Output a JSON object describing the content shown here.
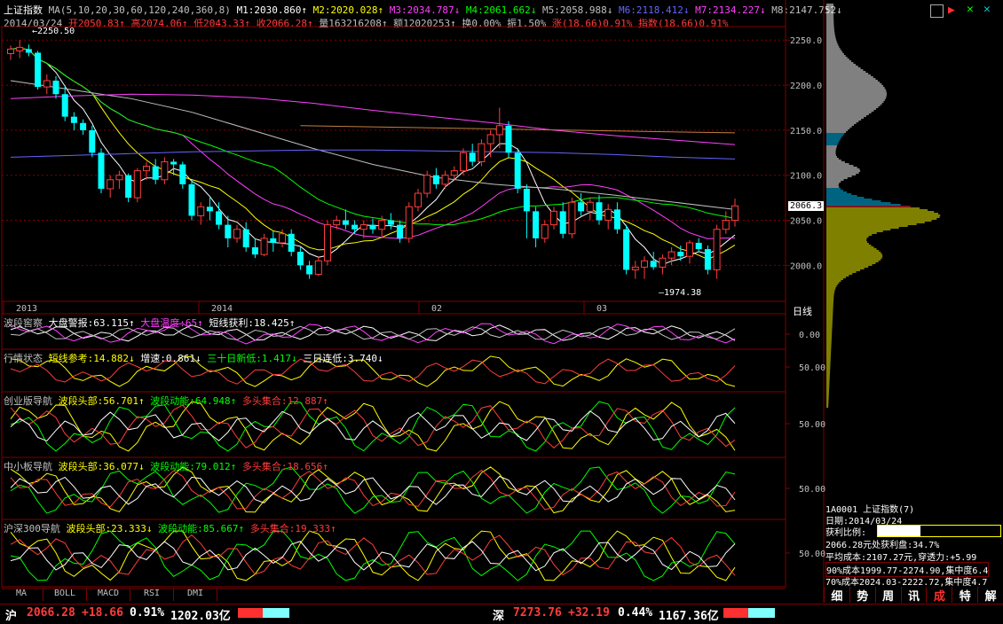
{
  "header": {
    "title": "上证指数",
    "ma_params": "MA(5,10,20,30,60,120,240,360,8)",
    "ma": [
      {
        "label": "M1:2030.860↑",
        "color": "#ffffff"
      },
      {
        "label": "M2:2020.028↑",
        "color": "#ffff00"
      },
      {
        "label": "M3:2034.787↓",
        "color": "#ff40ff"
      },
      {
        "label": "M4:2061.662↓",
        "color": "#00ff00"
      },
      {
        "label": "M5:2058.988↓",
        "color": "#c0c0c0"
      },
      {
        "label": "M6:2118.412↓",
        "color": "#6464ff"
      },
      {
        "label": "M7:2134.227↓",
        "color": "#ff40ff"
      },
      {
        "label": "M8:2147.752↓",
        "color": "#c0c0c0"
      }
    ],
    "date": "2014/03/24",
    "open": "开2050.83↑",
    "high": "高2074.06↑",
    "low": "低2043.33↑",
    "close": "收2066.28↑",
    "volume": "量163216208↑",
    "amount": "额12020253↑",
    "turnover": "换0.00%",
    "amplitude": "振1.50%",
    "change": "涨(18.66)0.91%",
    "index_chg": "指数(18.66)0.91%"
  },
  "price_chart": {
    "high_label": "2250.50",
    "low_label": "1974.38",
    "current_label": "2066.3",
    "yticks": [
      "2250.0",
      "2200.0",
      "2150.0",
      "2100.0",
      "2050.0",
      "2000.0"
    ],
    "xticks": [
      "2013",
      "2014",
      "02",
      "03"
    ],
    "period": "日线"
  },
  "panels": [
    {
      "name": "波段窖察",
      "items": [
        {
          "t": "大盘警报:63.115↑",
          "c": "#ffffff"
        },
        {
          "t": "大盘温度:65↑",
          "c": "#ff40ff"
        },
        {
          "t": "短线获利:18.425↑",
          "c": "#ffffff"
        }
      ],
      "tick": "0.00"
    },
    {
      "name": "行情状态",
      "items": [
        {
          "t": "短线参考:14.882↓",
          "c": "#ffff00"
        },
        {
          "t": "增速:0.861↓",
          "c": "#ffffff"
        },
        {
          "t": "三十日新低:1.417↓",
          "c": "#00ff00"
        },
        {
          "t": "三日连低:3.740↓",
          "c": "#ffffff"
        }
      ],
      "tick": "50.00"
    },
    {
      "name": "创业版导航",
      "items": [
        {
          "t": "波段头部:56.701↑",
          "c": "#ffff00"
        },
        {
          "t": "波段动能:64.948↑",
          "c": "#00ff00"
        },
        {
          "t": "多头集合:12.887↑",
          "c": "#ff3c3c"
        }
      ],
      "tick": "50.00"
    },
    {
      "name": "中小板导航",
      "items": [
        {
          "t": "波段头部:36.077↓",
          "c": "#ffff00"
        },
        {
          "t": "波段动能:79.012↑",
          "c": "#00ff00"
        },
        {
          "t": "多头集合:18.656↑",
          "c": "#ff3c3c"
        }
      ],
      "tick": "50.00"
    },
    {
      "name": "沪深300导航",
      "items": [
        {
          "t": "波段头部:23.333↓",
          "c": "#ffff00"
        },
        {
          "t": "波段动能:85.667↑",
          "c": "#00ff00"
        },
        {
          "t": "多头集合:19.333↑",
          "c": "#ff3c3c"
        }
      ],
      "tick": "50.00"
    }
  ],
  "tabs": [
    "MA",
    "BOLL",
    "MACD",
    "RSI",
    "DMI"
  ],
  "side_info": {
    "code": "1A0001 上证指数(7)",
    "date": "日期:2014/03/24",
    "profit_label": "获利比例:",
    "profit_value": "34.7%",
    "profit_fraction": 0.347,
    "line1": "2066.28元处获利盘:34.7%",
    "line2": "平均成本:2107.27元,穿透力:+5.99",
    "line3": "90%成本1999.77-2274.90,集中度6.4",
    "line4": "70%成本2024.03-2222.72,集中度4.7"
  },
  "side_tabs": [
    "细",
    "势",
    "周",
    "讯",
    "成",
    "特",
    "解"
  ],
  "status": {
    "sh_label": "沪",
    "sh_price": "2066.28",
    "sh_chg": "+18.66",
    "sh_pct": "0.91%",
    "sh_amt": "1202.03亿",
    "sz_label": "深",
    "sz_price": "7273.76",
    "sz_chg": "+32.19",
    "sz_pct": "0.44%",
    "sz_amt": "1167.36亿"
  },
  "chart_data": {
    "type": "candlestick",
    "ylim": [
      1960,
      2265
    ],
    "candles": [
      [
        2235,
        2244,
        2228,
        2240
      ],
      [
        2238,
        2250,
        2230,
        2242
      ],
      [
        2240,
        2245,
        2232,
        2236
      ],
      [
        2236,
        2238,
        2195,
        2198
      ],
      [
        2198,
        2212,
        2190,
        2205
      ],
      [
        2205,
        2210,
        2185,
        2190
      ],
      [
        2190,
        2200,
        2160,
        2165
      ],
      [
        2165,
        2170,
        2150,
        2158
      ],
      [
        2158,
        2162,
        2145,
        2150
      ],
      [
        2150,
        2155,
        2120,
        2125
      ],
      [
        2125,
        2130,
        2080,
        2085
      ],
      [
        2085,
        2100,
        2075,
        2095
      ],
      [
        2095,
        2105,
        2085,
        2100
      ],
      [
        2100,
        2102,
        2070,
        2075
      ],
      [
        2075,
        2108,
        2070,
        2105
      ],
      [
        2105,
        2115,
        2095,
        2110
      ],
      [
        2110,
        2118,
        2090,
        2095
      ],
      [
        2095,
        2120,
        2090,
        2115
      ],
      [
        2115,
        2118,
        2100,
        2112
      ],
      [
        2112,
        2115,
        2085,
        2090
      ],
      [
        2090,
        2095,
        2050,
        2055
      ],
      [
        2055,
        2070,
        2045,
        2065
      ],
      [
        2065,
        2075,
        2050,
        2060
      ],
      [
        2060,
        2070,
        2040,
        2045
      ],
      [
        2045,
        2055,
        2020,
        2030
      ],
      [
        2030,
        2045,
        2025,
        2040
      ],
      [
        2040,
        2048,
        2015,
        2020
      ],
      [
        2020,
        2030,
        2008,
        2012
      ],
      [
        2012,
        2035,
        2010,
        2030
      ],
      [
        2030,
        2038,
        2015,
        2025
      ],
      [
        2025,
        2040,
        2020,
        2035
      ],
      [
        2035,
        2040,
        2010,
        2015
      ],
      [
        2015,
        2020,
        1995,
        2000
      ],
      [
        2000,
        2005,
        1985,
        1990
      ],
      [
        1990,
        2010,
        1988,
        2005
      ],
      [
        2005,
        2050,
        2000,
        2045
      ],
      [
        2045,
        2055,
        2040,
        2050
      ],
      [
        2050,
        2062,
        2040,
        2045
      ],
      [
        2045,
        2050,
        2035,
        2040
      ],
      [
        2040,
        2050,
        2030,
        2045
      ],
      [
        2045,
        2052,
        2035,
        2040
      ],
      [
        2040,
        2055,
        2030,
        2050
      ],
      [
        2050,
        2058,
        2040,
        2045
      ],
      [
        2045,
        2050,
        2025,
        2030
      ],
      [
        2030,
        2070,
        2025,
        2065
      ],
      [
        2065,
        2085,
        2060,
        2080
      ],
      [
        2080,
        2105,
        2075,
        2100
      ],
      [
        2100,
        2108,
        2085,
        2090
      ],
      [
        2090,
        2105,
        2085,
        2100
      ],
      [
        2100,
        2110,
        2095,
        2105
      ],
      [
        2105,
        2130,
        2100,
        2125
      ],
      [
        2125,
        2135,
        2110,
        2115
      ],
      [
        2115,
        2140,
        2110,
        2135
      ],
      [
        2135,
        2150,
        2120,
        2145
      ],
      [
        2145,
        2175,
        2130,
        2155
      ],
      [
        2155,
        2160,
        2120,
        2125
      ],
      [
        2125,
        2130,
        2080,
        2085
      ],
      [
        2085,
        2090,
        2030,
        2060
      ],
      [
        2060,
        2065,
        2020,
        2030
      ],
      [
        2030,
        2050,
        2025,
        2045
      ],
      [
        2045,
        2065,
        2040,
        2060
      ],
      [
        2060,
        2070,
        2030,
        2035
      ],
      [
        2035,
        2075,
        2030,
        2070
      ],
      [
        2070,
        2080,
        2055,
        2060
      ],
      [
        2060,
        2075,
        2050,
        2070
      ],
      [
        2070,
        2078,
        2045,
        2050
      ],
      [
        2050,
        2068,
        2040,
        2062
      ],
      [
        2062,
        2070,
        2035,
        2040
      ],
      [
        2040,
        2045,
        1990,
        1995
      ],
      [
        1995,
        2005,
        1985,
        1998
      ],
      [
        1998,
        2010,
        1985,
        2005
      ],
      [
        2005,
        2015,
        1995,
        1998
      ],
      [
        1998,
        2012,
        1990,
        2008
      ],
      [
        2008,
        2020,
        2000,
        2015
      ],
      [
        2015,
        2022,
        2005,
        2010
      ],
      [
        2010,
        2028,
        2002,
        2025
      ],
      [
        2025,
        2030,
        2015,
        2018
      ],
      [
        2018,
        2022,
        1990,
        1995
      ],
      [
        1995,
        2045,
        1985,
        2040
      ],
      [
        2040,
        2060,
        2035,
        2050
      ],
      [
        2050,
        2074,
        2043,
        2066
      ]
    ]
  }
}
